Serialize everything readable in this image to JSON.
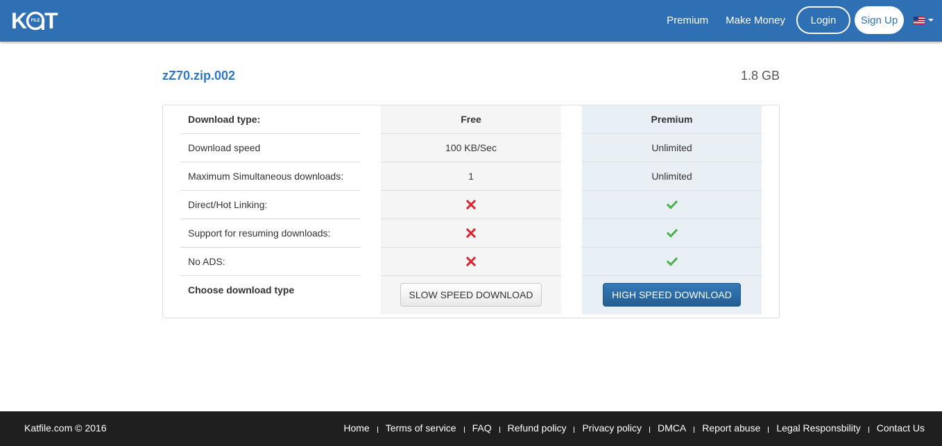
{
  "header": {
    "logo": {
      "left": "K",
      "ring_text": "FILE",
      "right": "T"
    },
    "nav": {
      "premium": "Premium",
      "make_money": "Make Money",
      "login": "Login",
      "signup": "Sign Up"
    },
    "language_flag": "us-flag-icon"
  },
  "file": {
    "name": "zZ70.zip.002",
    "size": "1.8 GB"
  },
  "table": {
    "labels": {
      "head": "Download type:",
      "speed": "Download speed",
      "simultaneous": "Maximum Simultaneous downloads:",
      "hotlinking": "Direct/Hot Linking:",
      "resuming": "Support for resuming downloads:",
      "no_ads": "No ADS:",
      "choose": "Choose download type"
    },
    "free": {
      "head": "Free",
      "speed": "100 KB/Sec",
      "simultaneous": "1",
      "hotlinking": "x-icon",
      "resuming": "x-icon",
      "no_ads": "x-icon",
      "button": "SLOW SPEED DOWNLOAD"
    },
    "premium": {
      "head": "Premium",
      "speed": "Unlimited",
      "simultaneous": "Unlimited",
      "hotlinking": "check-icon",
      "resuming": "check-icon",
      "no_ads": "check-icon",
      "button": "HIGH SPEED DOWNLOAD"
    }
  },
  "colors": {
    "header_bg": "#2f6fb4",
    "filename": "#2f78c4",
    "x_mark": "#d9232e",
    "check_mark": "#4cae4c",
    "high_button": "#2a6aa6",
    "footer_bg": "#1f1f1f"
  },
  "footer": {
    "copyright": "Katfile.com © 2016",
    "links": [
      "Home",
      "Terms of service",
      "FAQ",
      "Refund policy",
      "Privacy policy",
      "DMCA",
      "Report abuse",
      "Legal Responsbility",
      "Contact Us"
    ]
  }
}
